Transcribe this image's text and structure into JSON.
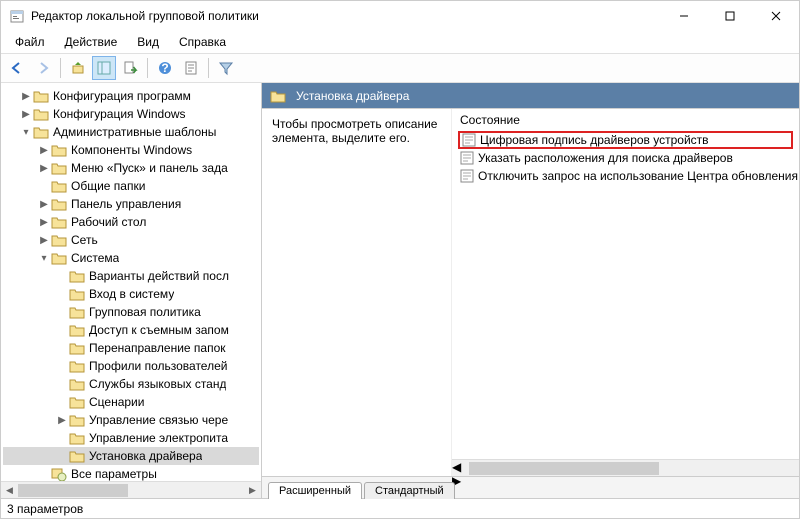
{
  "window": {
    "title": "Редактор локальной групповой политики"
  },
  "menu": {
    "file": "Файл",
    "action": "Действие",
    "view": "Вид",
    "help": "Справка"
  },
  "tree": {
    "n0": "Конфигурация программ",
    "n1": "Конфигурация Windows",
    "n2": "Административные шаблоны",
    "n3": "Компоненты Windows",
    "n4": "Меню «Пуск» и панель зада",
    "n5": "Общие папки",
    "n6": "Панель управления",
    "n7": "Рабочий стол",
    "n8": "Сеть",
    "n9": "Система",
    "n10": "Варианты действий посл",
    "n11": "Вход в систему",
    "n12": "Групповая политика",
    "n13": "Доступ к съемным запом",
    "n14": "Перенаправление папок",
    "n15": "Профили пользователей",
    "n16": "Службы языковых станд",
    "n17": "Сценарии",
    "n18": "Управление связью чере",
    "n19": "Управление электропита",
    "n20": "Установка драйвера",
    "n21": "Все параметры"
  },
  "detail": {
    "header": "Установка драйвера",
    "description": "Чтобы просмотреть описание элемента, выделите его.",
    "column": "Состояние",
    "items": {
      "i0": "Цифровая подпись драйверов устройств",
      "i1": "Указать расположения для поиска драйверов",
      "i2": "Отключить запрос на использование Центра обновления"
    }
  },
  "tabs": {
    "extended": "Расширенный",
    "standard": "Стандартный"
  },
  "status": "3 параметров"
}
